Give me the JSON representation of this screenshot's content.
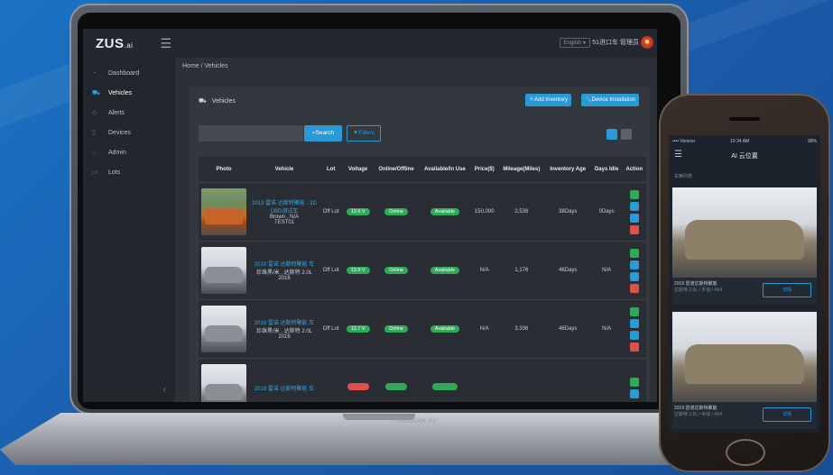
{
  "app": {
    "logo": "ZUS",
    "logo_suffix": ".ai",
    "language": "English",
    "user": "51进口车 管理员"
  },
  "laptop": {
    "label": "MacBook Air"
  },
  "sidebar": {
    "items": [
      {
        "label": "Dashboard",
        "icon": "dashboard-icon",
        "active": false
      },
      {
        "label": "Vehicles",
        "icon": "car-icon",
        "active": true
      },
      {
        "label": "Alerts",
        "icon": "bell-icon",
        "active": false
      },
      {
        "label": "Devices",
        "icon": "device-icon",
        "active": false
      },
      {
        "label": "Admin",
        "icon": "user-icon",
        "active": false
      },
      {
        "label": "Lots",
        "icon": "lot-icon",
        "active": false
      }
    ]
  },
  "breadcrumb": "Home / Vehicles",
  "panel": {
    "title": "Vehicles",
    "add_inventory": "Add Inventory",
    "device_installation": "Device Installation",
    "search_label": "Search",
    "filters_label": "Filters"
  },
  "table": {
    "headers": [
      "Photo",
      "Vehicle",
      "Lot",
      "Voltage",
      "Online/Offline",
      "Available/In Use",
      "Price($)",
      "Mileage(Miles)",
      "Inventory Age",
      "Days Idle",
      "Action"
    ],
    "rows": [
      {
        "vehicle_name": "2019 雷诺 达斯特聚能 - 3D OBD测试车",
        "vehicle_detail": "Brown , N/A",
        "vehicle_code": "TEST01",
        "lot": "Off Lot",
        "voltage": "13.6 V",
        "online": "Online",
        "available": "Available",
        "price": "150,000",
        "mileage": "2,538",
        "age": "38Days",
        "idle": "0Days",
        "photo": "orange"
      },
      {
        "vehicle_name": "2018 雷诺 达斯特聚能 车",
        "vehicle_detail": "珍珠黑/米 , 达斯特 2.0L",
        "vehicle_code": "2016",
        "lot": "Off Lot",
        "voltage": "13.9 V",
        "online": "Online",
        "available": "Available",
        "price": "N/A",
        "mileage": "1,176",
        "age": "46Days",
        "idle": "N/A",
        "photo": "silver"
      },
      {
        "vehicle_name": "2018 雷诺 达斯特聚能 车",
        "vehicle_detail": "珍珠黑/米 , 达斯特 2.0L",
        "vehicle_code": "2016",
        "lot": "Off Lot",
        "voltage": "12.7 V",
        "online": "Online",
        "available": "Available",
        "price": "N/A",
        "mileage": "3,336",
        "age": "46Days",
        "idle": "N/A",
        "photo": "silver"
      },
      {
        "vehicle_name": "2018 雷诺 达斯特聚能 车",
        "vehicle_detail": "",
        "vehicle_code": "",
        "lot": "",
        "voltage": "",
        "online": "",
        "available": "",
        "price": "",
        "mileage": "",
        "age": "",
        "idle": "",
        "photo": "silver"
      }
    ]
  },
  "phone": {
    "status_left": "•••• Verizon",
    "status_time": "10:34 AM",
    "status_right": "99%",
    "title": "AI 云位置",
    "subtitle": "车辆列表",
    "cards": [
      {
        "caption": "2019 雷诺达斯特聚能",
        "sub": "达斯特 2.0L / 手动 / 4X4",
        "button": "详情"
      },
      {
        "caption": "2019 雷诺达斯特聚能",
        "sub": "达斯特 2.0L / 手动 / 4X4",
        "button": "详情"
      }
    ]
  },
  "colors": {
    "accent": "#2a9ad6",
    "success": "#2eaa58",
    "danger": "#e0504a",
    "warning": "#e2a13a"
  }
}
